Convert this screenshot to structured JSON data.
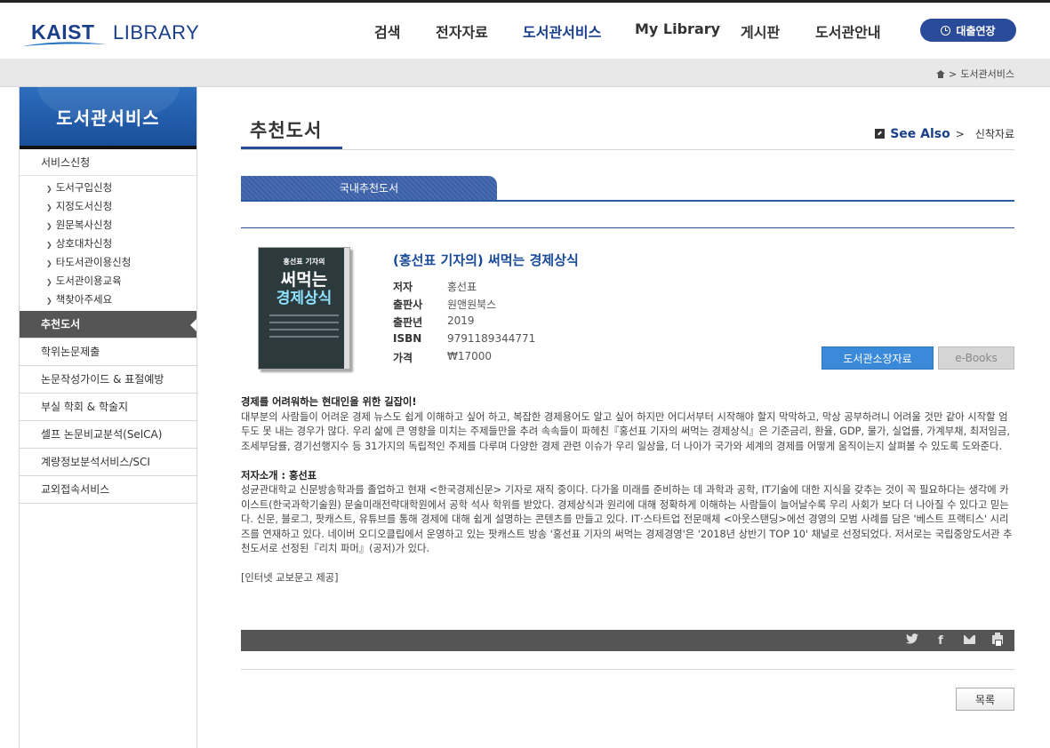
{
  "header": {
    "logo_kaist": "KAIST",
    "logo_library": "LIBRARY",
    "nav": [
      {
        "label": "검색"
      },
      {
        "label": "전자자료"
      },
      {
        "label": "도서관서비스"
      },
      {
        "label": "My Library"
      },
      {
        "label": "게시판"
      },
      {
        "label": "도서관안내"
      }
    ],
    "renew_button": "대출연장",
    "active_nav_color": "#1a3f8a",
    "brand_color": "#2a4a9a"
  },
  "breadcrumb": {
    "separator": ">",
    "current": "도서관서비스"
  },
  "sidebar": {
    "title": "도서관서비스",
    "group_label": "서비스신청",
    "sub_items": [
      {
        "label": "도서구입신청"
      },
      {
        "label": "지정도서신청"
      },
      {
        "label": "원문복사신청"
      },
      {
        "label": "상호대차신청"
      },
      {
        "label": "타도서관이용신청"
      },
      {
        "label": "도서관이용교육"
      },
      {
        "label": "책찾아주세요"
      }
    ],
    "menu": [
      {
        "label": "추천도서",
        "active": true
      },
      {
        "label": "학위논문제출"
      },
      {
        "label": "논문작성가이드 & 표절예방"
      },
      {
        "label": "부실 학회 & 학술지"
      },
      {
        "label": "셀프 논문비교분석(SelCA)"
      },
      {
        "label": "계량정보분석서비스/SCI"
      },
      {
        "label": "교외접속서비스"
      }
    ]
  },
  "content": {
    "page_title": "추천도서",
    "see_also_label": "See Also",
    "see_also_sep": ">",
    "see_also_link": "신착자료",
    "tab_label": "국내추천도서",
    "book": {
      "cover_small": "홍선표 기자의",
      "cover_big1": "써먹는",
      "cover_big2": "경제상식",
      "title": "(홍선표 기자의) 써먹는 경제상식",
      "meta": [
        {
          "label": "저자",
          "value": "홍선표"
        },
        {
          "label": "출판사",
          "value": "원앤원북스"
        },
        {
          "label": "출판년",
          "value": "2019"
        },
        {
          "label": "ISBN",
          "value": "9791189344771"
        },
        {
          "label": "가격",
          "value": "₩17000"
        }
      ],
      "btn_holding": "도서관소장자료",
      "btn_ebooks": "e-Books"
    },
    "description": {
      "heading": "경제를 어려워하는 현대인을 위한 길잡이!",
      "body": "대부분의 사람들이 어려운 경제 뉴스도 쉽게 이해하고 싶어 하고, 복잡한 경제용어도 알고 싶어 하지만 어디서부터 시작해야 할지 막막하고, 막상 공부하려니 어려울 것만 같아 시작할 엄두도 못 내는 경우가 많다. 우리 삶에 큰 영향을 미치는 주제들만을 추려 속속들이 파헤친『홍선표 기자의 써먹는 경제상식』은 기준금리, 환율, GDP, 물가, 실업률, 가계부채, 최저임금, 조세부담률, 경기선행지수 등 31가지의 독립적인 주제를 다루며 다양한 경제 관련 이슈가 우리 일상을, 더 나아가 국가와 세계의 경제를 어떻게 움직이는지 살펴볼 수 있도록 도와준다.",
      "author_heading": "저자소개 : 홍선표",
      "author_body": "성균관대학교 신문방송학과를 졸업하고 현재 <한국경제신문> 기자로 재직 중이다. 다가올 미래를 준비하는 데 과학과 공학, IT기술에 대한 지식을 갖추는 것이 꼭 필요하다는 생각에 카이스트(한국과학기술원) 문술미래전략대학원에서 공학 석사 학위를 받았다. 경제상식과 원리에 대해 정확하게 이해하는 사람들이 늘어날수록 우리 사회가 보다 더 나아질 수 있다고 믿는다. 신문, 블로그, 팟캐스트, 유튜브를 통해 경제에 대해 쉽게 설명하는 콘텐츠를 만들고 있다. IT·스타트업 전문매체 <아웃스탠딩>에선 경영의 모범 사례를 담은 '베스트 프랙티스' 시리즈를 연재하고 있다. 네이버 오디오클립에서 운영하고 있는 팟캐스트 방송 '홍선표 기자의 써먹는 경제경영'은 '2018년 상반기 TOP 10' 채널로 선정되었다. 저서로는 국립중앙도서관 추천도서로 선정된『리치 파머』(공저)가 있다.",
      "source": "[인터넷 교보문고 제공]"
    },
    "share": {
      "twitter": "twitter-icon",
      "facebook": "facebook-icon",
      "email": "mail-icon",
      "print": "print-icon"
    },
    "list_button": "목록"
  }
}
